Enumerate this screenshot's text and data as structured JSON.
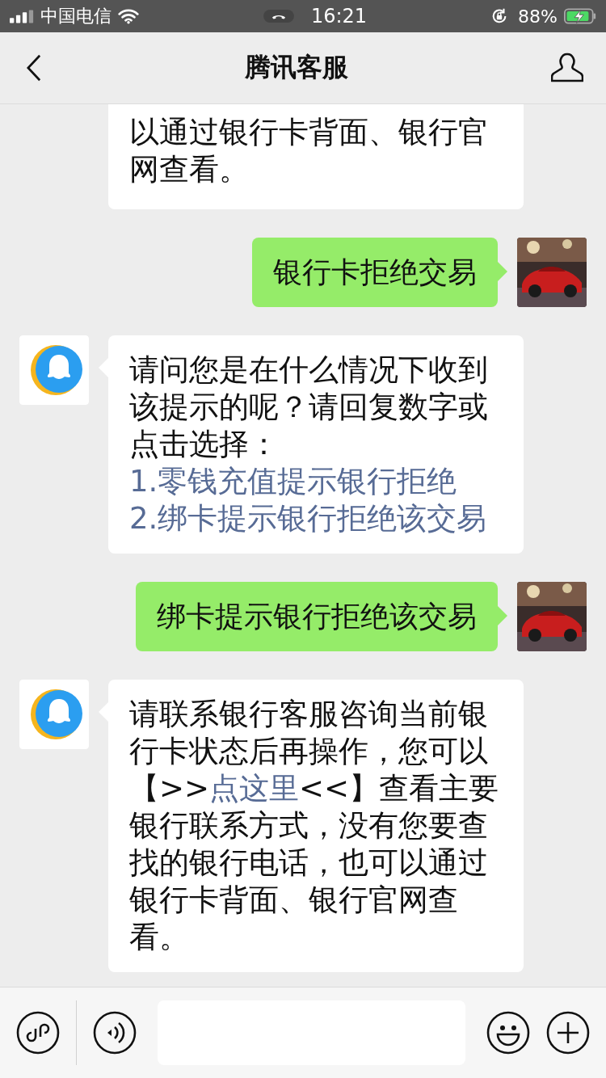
{
  "status_bar": {
    "carrier": "中国电信",
    "time": "16:21",
    "battery": "88%"
  },
  "header": {
    "title": "腾讯客服"
  },
  "messages": [
    {
      "kind": "incoming",
      "avatar": false,
      "paragraphs": [
        [
          {
            "kind": "text",
            "text": "以通过银行卡背面、银行官网查看。"
          }
        ]
      ]
    },
    {
      "kind": "outgoing",
      "avatar": true,
      "paragraphs": [
        [
          {
            "kind": "text",
            "text": "银行卡拒绝交易"
          }
        ]
      ]
    },
    {
      "kind": "incoming",
      "avatar": true,
      "paragraphs": [
        [
          {
            "kind": "text",
            "text": "请问您是在什么情况下收到该提示的呢？请回复数字或点击选择："
          }
        ],
        [
          {
            "kind": "link",
            "text": "1.零钱充值提示银行拒绝"
          }
        ],
        [
          {
            "kind": "link",
            "text": "2.绑卡提示银行拒绝该交易"
          }
        ]
      ]
    },
    {
      "kind": "outgoing",
      "avatar": true,
      "paragraphs": [
        [
          {
            "kind": "text",
            "text": "绑卡提示银行拒绝该交易"
          }
        ]
      ]
    },
    {
      "kind": "incoming",
      "avatar": true,
      "paragraphs": [
        [
          {
            "kind": "text",
            "text": "请联系银行客服咨询当前银行卡状态后再操作，您可以【>>"
          },
          {
            "kind": "link",
            "text": "点这里"
          },
          {
            "kind": "text",
            "text": "<<】查看主要银行联系方式，没有您要查找的银行电话，也可以通过银行卡背面、银行官网查看。"
          }
        ]
      ]
    }
  ]
}
